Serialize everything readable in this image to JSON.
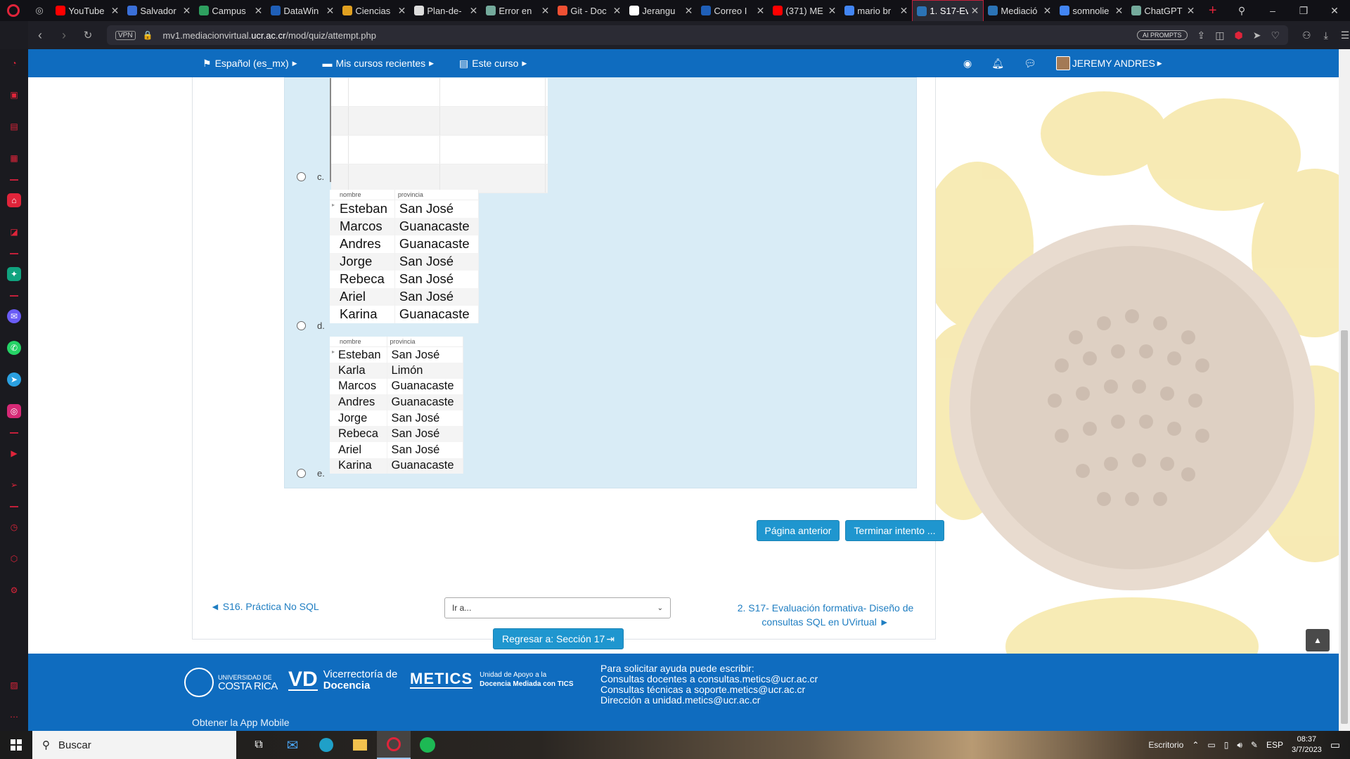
{
  "browser": {
    "tabs": [
      {
        "title": "YouTube",
        "color": "#ff0000"
      },
      {
        "title": "Salvador",
        "color": "#3a6fd8"
      },
      {
        "title": "Campus",
        "color": "#2e9f5f"
      },
      {
        "title": "DataWin",
        "color": "#1f5fb8"
      },
      {
        "title": "Ciencias",
        "color": "#e0a020"
      },
      {
        "title": "Plan-de-",
        "color": "#dddddd"
      },
      {
        "title": "Error en",
        "color": "#74aa9c"
      },
      {
        "title": "Git - Doc",
        "color": "#f05033"
      },
      {
        "title": "Jerangu",
        "color": "#ffffff"
      },
      {
        "title": "Correo I",
        "color": "#1f5fb8"
      },
      {
        "title": "(371) ME",
        "color": "#ff0000"
      },
      {
        "title": "mario br",
        "color": "#4285f4"
      },
      {
        "title": "1. S17-Ev",
        "color": "#2b73b5",
        "active": true
      },
      {
        "title": "Mediació",
        "color": "#2b73b5"
      },
      {
        "title": "somnolie",
        "color": "#4285f4"
      },
      {
        "title": "ChatGPT",
        "color": "#74aa9c"
      }
    ],
    "url_prefix": "mv1.mediacionvirtual.",
    "url_domain": "ucr.ac.cr",
    "url_path": "/mod/quiz/attempt.php",
    "vpn_label": "VPN",
    "ai_prompts_label": "AI PROMPTS"
  },
  "topnav": {
    "language": "Español (es_mx)",
    "recent_courses": "Mis cursos recientes",
    "this_course": "Este curso",
    "user_name": "JEREMY ANDRES"
  },
  "question": {
    "options": [
      {
        "letter": "c.",
        "type": "empty-grid"
      },
      {
        "letter": "d.",
        "headers": [
          "nombre",
          "provincia"
        ],
        "rows": [
          [
            "Esteban",
            "San José"
          ],
          [
            "Marcos",
            "Guanacaste"
          ],
          [
            "Andres",
            "Guanacaste"
          ],
          [
            "Jorge",
            "San José"
          ],
          [
            "Rebeca",
            "San José"
          ],
          [
            "Ariel",
            "San José"
          ],
          [
            "Karina",
            "Guanacaste"
          ]
        ]
      },
      {
        "letter": "e.",
        "headers": [
          "nombre",
          "provincia"
        ],
        "rows": [
          [
            "Esteban",
            "San José"
          ],
          [
            "Karla",
            "Limón"
          ],
          [
            "Marcos",
            "Guanacaste"
          ],
          [
            "Andres",
            "Guanacaste"
          ],
          [
            "Jorge",
            "San José"
          ],
          [
            "Rebeca",
            "San José"
          ],
          [
            "Ariel",
            "San José"
          ],
          [
            "Karina",
            "Guanacaste"
          ]
        ]
      }
    ]
  },
  "buttons": {
    "previous_page": "Página anterior",
    "finish_attempt": "Terminar intento ...",
    "return_section": "Regresar a: Sección 17"
  },
  "activity_nav": {
    "prev_link": "◄ S16. Práctica No SQL",
    "jump_placeholder": "Ir a...",
    "next_link_line1": "2. S17- Evaluación formativa- Diseño de",
    "next_link_line2": "consultas SQL en UVirtual ►"
  },
  "footer": {
    "ucr_line1": "UNIVERSIDAD DE",
    "ucr_line2": "COSTA RICA",
    "vd_abbr": "VD",
    "vd_line1": "Vicerrectoría de",
    "vd_line2": "Docencia",
    "metics_abbr": "METICS",
    "metics_line1": "Unidad de Apoyo a la",
    "metics_line2": "Docencia Mediada con TICS",
    "help_title": "Para solicitar ayuda puede escribir:",
    "help_line1": "Consultas docentes a consultas.metics@ucr.ac.cr",
    "help_line2": "Consultas técnicas a soporte.metics@ucr.ac.cr",
    "help_line3": "Dirección a unidad.metics@ucr.ac.cr",
    "app_link": "Obtener la App Mobile"
  },
  "taskbar": {
    "search_placeholder": "Buscar",
    "desktop_label": "Escritorio",
    "language": "ESP",
    "time": "08:37",
    "date": "3/7/2023"
  }
}
